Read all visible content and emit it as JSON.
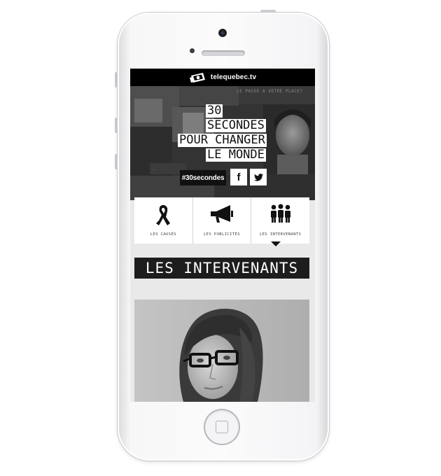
{
  "header": {
    "logo_icon": "telequebec-logo-icon",
    "site_name": "telequebec.tv"
  },
  "hero": {
    "tagline": "LE PASSE A VOTRE PLACE?",
    "title_lines": [
      "30",
      "SECONDES",
      "POUR CHANGER",
      "LE MONDE"
    ],
    "hashtag": "#30secondes",
    "facebook_glyph": "f"
  },
  "nav": {
    "items": [
      {
        "label": "LES CAUSES",
        "icon": "ribbon-icon"
      },
      {
        "label": "LES PUBLICITÉS",
        "icon": "megaphone-icon"
      },
      {
        "label": "LES INTERVENANTS",
        "icon": "people-icon"
      }
    ],
    "active_index": 2
  },
  "section": {
    "title": "LES INTERVENANTS"
  },
  "colors": {
    "topbar": "#000000",
    "section_bg": "#1d1d1d",
    "tile_bg": "#ffffff",
    "phone_body": "#f4f4f6"
  }
}
